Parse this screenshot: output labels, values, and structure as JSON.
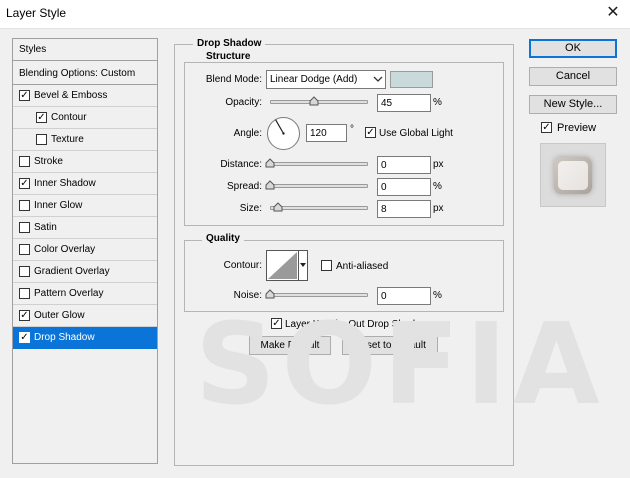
{
  "window": {
    "title": "Layer Style",
    "close_symbol": "✕"
  },
  "nav": {
    "styles_label": "Styles",
    "blending_label": "Blending Options: Custom",
    "items": [
      {
        "label": "Bevel & Emboss",
        "checked": true
      },
      {
        "label": "Contour",
        "checked": true
      },
      {
        "label": "Texture",
        "checked": false
      },
      {
        "label": "Stroke",
        "checked": false
      },
      {
        "label": "Inner Shadow",
        "checked": true
      },
      {
        "label": "Inner Glow",
        "checked": false
      },
      {
        "label": "Satin",
        "checked": false
      },
      {
        "label": "Color Overlay",
        "checked": false
      },
      {
        "label": "Gradient Overlay",
        "checked": false
      },
      {
        "label": "Pattern Overlay",
        "checked": false
      },
      {
        "label": "Outer Glow",
        "checked": true
      },
      {
        "label": "Drop Shadow",
        "checked": true,
        "selected": true
      }
    ]
  },
  "panel": {
    "title": "Drop Shadow",
    "structure": {
      "title": "Structure",
      "blend_mode_label": "Blend Mode:",
      "blend_mode_value": "Linear Dodge (Add)",
      "blend_color": "#c8dadb",
      "opacity_label": "Opacity:",
      "opacity_value": "45",
      "opacity_fraction": 0.45,
      "opacity_unit": "%",
      "angle_label": "Angle:",
      "angle_value": "120",
      "angle_unit": "°",
      "global_light_label": "Use Global Light",
      "global_light_checked": true,
      "distance_label": "Distance:",
      "distance_value": "0",
      "distance_unit": "px",
      "spread_label": "Spread:",
      "spread_value": "0",
      "spread_unit": "%",
      "size_label": "Size:",
      "size_value": "8",
      "size_unit": "px"
    },
    "quality": {
      "title": "Quality",
      "contour_label": "Contour:",
      "anti_aliased_label": "Anti-aliased",
      "anti_aliased_checked": false,
      "noise_label": "Noise:",
      "noise_value": "0",
      "noise_unit": "%"
    },
    "knockout_label": "Layer Knocks Out Drop Shadow",
    "knockout_checked": true,
    "make_default_label": "Make Default",
    "reset_default_label": "Reset to Default"
  },
  "actions": {
    "ok_label": "OK",
    "cancel_label": "Cancel",
    "new_style_label": "New Style...",
    "preview_label": "Preview",
    "preview_checked": true
  },
  "watermark": "SOFIA",
  "colors": {
    "accent": "#0a74d8",
    "window_bg": "#f0f0f0"
  },
  "icons": [
    "close-icon",
    "checkbox-checked-icon",
    "checkbox-unchecked-icon",
    "dropdown-arrow-icon",
    "slider-thumb-icon",
    "angle-dial-icon",
    "contour-curve-icon"
  ]
}
